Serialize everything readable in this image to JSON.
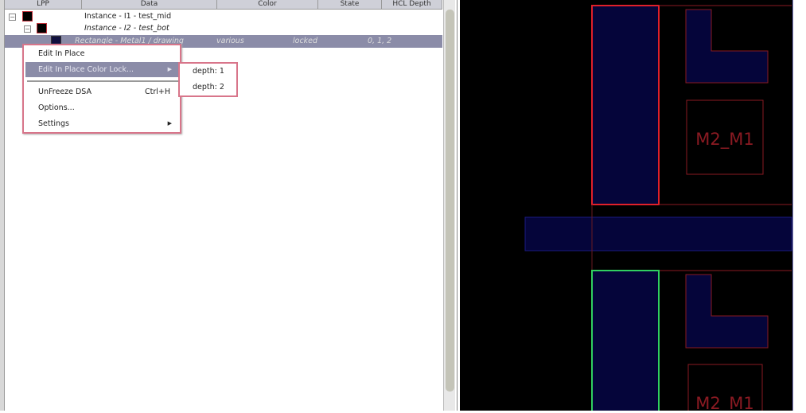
{
  "tree": {
    "columns": [
      "LPP",
      "Data",
      "Color",
      "State",
      "HCL Depth"
    ],
    "rows": [
      {
        "data": "Instance - I1 - test_mid",
        "color": "",
        "state": "",
        "depth": ""
      },
      {
        "data": "Instance - I2 - test_bot",
        "color": "",
        "state": "",
        "depth": ""
      },
      {
        "data": "Rectangle - Metal1 / drawing",
        "color": "various",
        "state": "locked",
        "depth": "0, 1, 2"
      }
    ]
  },
  "context_menu": {
    "items": [
      {
        "label": "Edit In Place"
      },
      {
        "label": "Edit In Place Color Lock..."
      },
      {
        "label": "UnFreeze DSA",
        "shortcut": "Ctrl+H"
      },
      {
        "label": "Options..."
      },
      {
        "label": "Settings"
      }
    ],
    "submenu": [
      "depth: 1",
      "depth: 2"
    ]
  },
  "canvas": {
    "labels": [
      "M2_M1",
      "M2_M1"
    ],
    "colors": {
      "background": "#000000",
      "highlight_red": "#e0202a",
      "highlight_green": "#30d060",
      "metal_fill": "#05053a"
    }
  }
}
